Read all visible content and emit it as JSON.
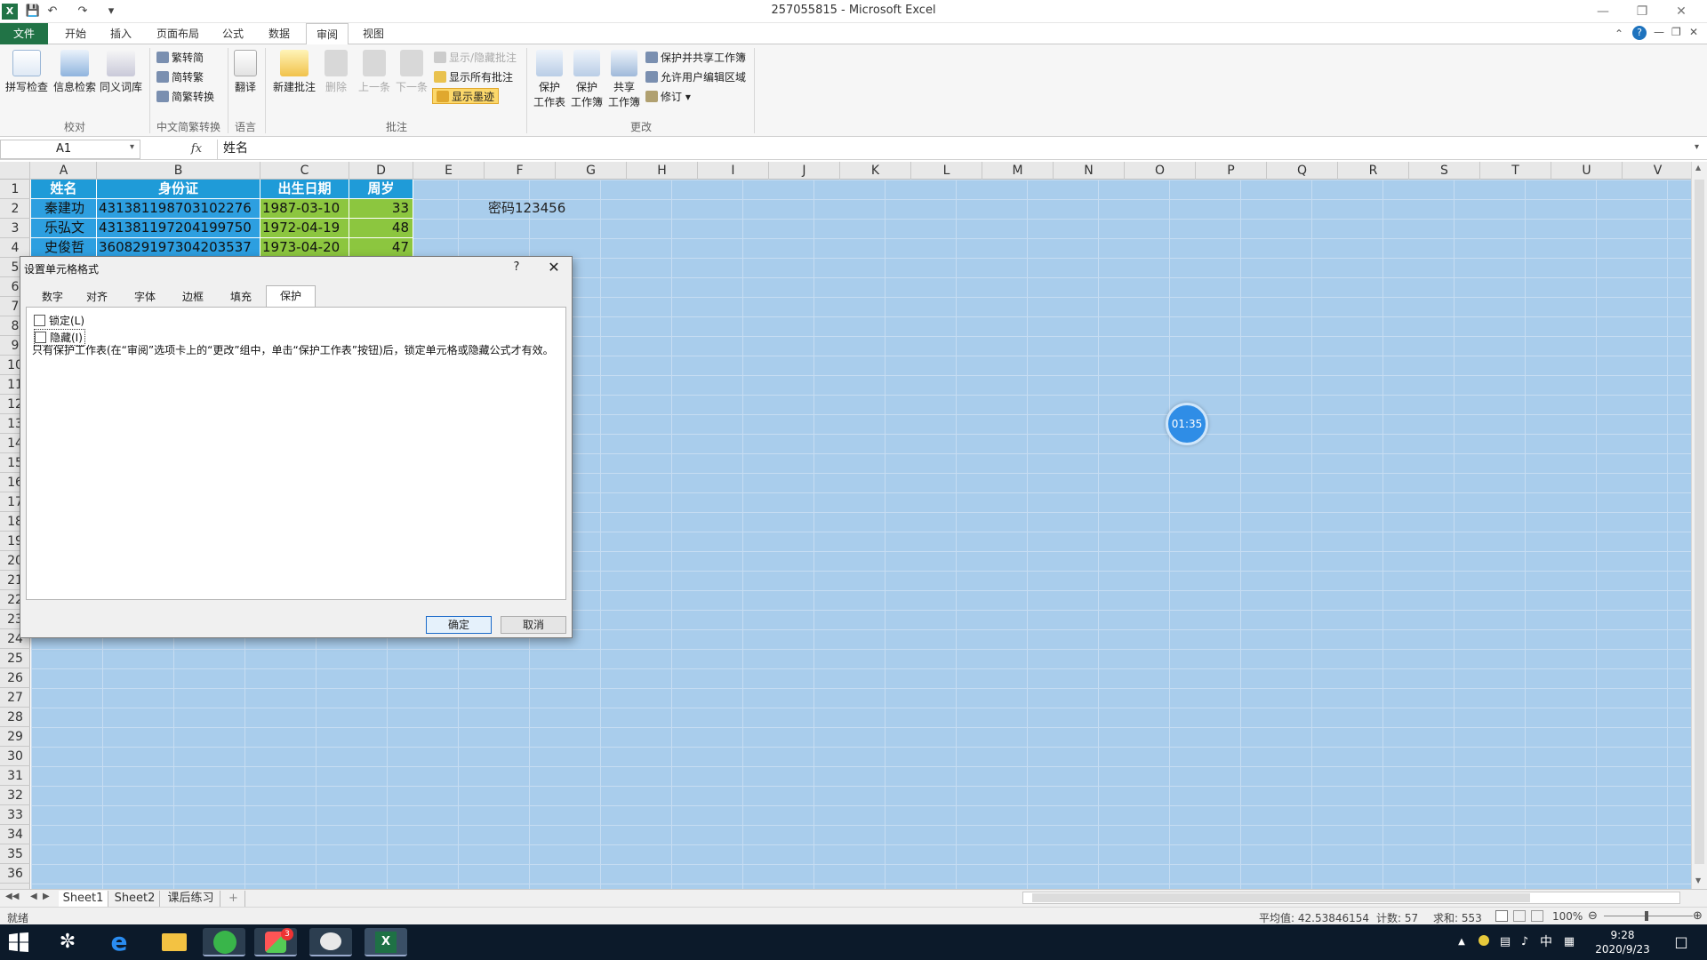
{
  "window": {
    "title": "257055815 - Microsoft Excel"
  },
  "ribbon_tabs": [
    "文件",
    "开始",
    "插入",
    "页面布局",
    "公式",
    "数据",
    "审阅",
    "视图"
  ],
  "active_tab": "审阅",
  "ribbon": {
    "proofing": {
      "spelling": "拼写检查",
      "research": "信息检索",
      "thesaurus": "同义词库",
      "group": "校对"
    },
    "chinese_conv": {
      "t2s": "繁转简",
      "s2t": "简转繁",
      "convert": "简繁转换",
      "group": "中文简繁转换"
    },
    "language": {
      "translate": "翻译",
      "group": "语言"
    },
    "comments": {
      "new": "新建批注",
      "delete": "删除",
      "prev": "上一条",
      "next": "下一条",
      "show_hide": "显示/隐藏批注",
      "show_all": "显示所有批注",
      "show_ink": "显示墨迹",
      "group": "批注"
    },
    "changes": {
      "protect_sheet_1": "保护",
      "protect_sheet_2": "工作表",
      "protect_book_1": "保护",
      "protect_book_2": "工作簿",
      "share_book_1": "共享",
      "share_book_2": "工作簿",
      "protect_share": "保护并共享工作簿",
      "allow_edit": "允许用户编辑区域",
      "track": "修订",
      "group": "更改"
    }
  },
  "formula_bar": {
    "name_box": "A1",
    "fx": "fx",
    "formula": "姓名"
  },
  "columns": [
    "A",
    "B",
    "C",
    "D",
    "E",
    "F",
    "G",
    "H",
    "I",
    "J",
    "K",
    "L",
    "M",
    "N",
    "O",
    "P",
    "Q",
    "R",
    "S",
    "T",
    "U",
    "V"
  ],
  "rows": [
    "1",
    "2",
    "3",
    "4",
    "5",
    "6",
    "7",
    "8",
    "9",
    "10",
    "11",
    "12",
    "13",
    "14",
    "15",
    "16",
    "17",
    "18",
    "19",
    "20",
    "21",
    "22",
    "23",
    "24",
    "25",
    "26",
    "27",
    "28",
    "29",
    "30",
    "31",
    "32",
    "33",
    "34",
    "35",
    "36"
  ],
  "table": {
    "headers": [
      "姓名",
      "身份证",
      "出生日期",
      "周岁"
    ],
    "rows": [
      [
        "秦建功",
        "431381198703102276",
        "1987-03-10",
        "33"
      ],
      [
        "乐弘文",
        "431381197204199750",
        "1972-04-19",
        "48"
      ],
      [
        "史俊哲",
        "360829197304203537",
        "1973-04-20",
        "47"
      ]
    ]
  },
  "note_cell": "密码123456",
  "dialog": {
    "title": "设置单元格格式",
    "help": "?",
    "tabs": [
      "数字",
      "对齐",
      "字体",
      "边框",
      "填充",
      "保护"
    ],
    "active_tab": "保护",
    "locked_label": "锁定(L)",
    "hidden_label": "隐藏(I)",
    "info": "只有保护工作表(在“审阅”选项卡上的“更改”组中，单击“保护工作表”按钮)后，锁定单元格或隐藏公式才有效。",
    "ok": "确定",
    "cancel": "取消"
  },
  "timer": "01:35",
  "sheet_tabs": [
    "Sheet1",
    "Sheet2",
    "课后练习"
  ],
  "status": {
    "ready": "就绪",
    "average": "平均值: 42.53846154",
    "count": "计数: 57",
    "sum": "求和: 553",
    "zoom": "100%"
  },
  "taskbar": {
    "tray_lang": "中",
    "time": "9:28",
    "date": "2020/9/23",
    "badge": "3"
  },
  "colors": {
    "excel_green": "#217346",
    "header_blue": "#1f9bd8",
    "header_green": "#7dbf3e",
    "selection": "#a9cdec"
  }
}
